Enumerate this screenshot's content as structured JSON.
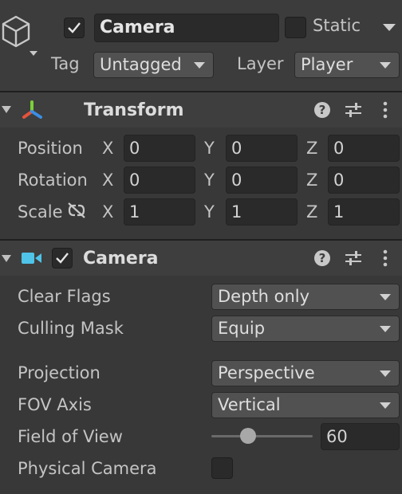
{
  "gameobject": {
    "active": true,
    "name": "Camera",
    "static_label": "Static",
    "static_checked": false,
    "tag_label": "Tag",
    "tag_value": "Untagged",
    "layer_label": "Layer",
    "layer_value": "Player"
  },
  "transform": {
    "title": "Transform",
    "rows": [
      {
        "label": "Position",
        "x": "0",
        "y": "0",
        "z": "0"
      },
      {
        "label": "Rotation",
        "x": "0",
        "y": "0",
        "z": "0"
      },
      {
        "label": "Scale",
        "x": "1",
        "y": "1",
        "z": "1"
      }
    ],
    "axis": {
      "x": "X",
      "y": "Y",
      "z": "Z"
    }
  },
  "camera": {
    "title": "Camera",
    "enabled": true,
    "fields": {
      "clear_flags": {
        "label": "Clear Flags",
        "value": "Depth only"
      },
      "culling_mask": {
        "label": "Culling Mask",
        "value": "Equip"
      },
      "projection": {
        "label": "Projection",
        "value": "Perspective"
      },
      "fov_axis": {
        "label": "FOV Axis",
        "value": "Vertical"
      },
      "field_of_view": {
        "label": "Field of View",
        "value": "60",
        "slider_fraction": 0.36
      },
      "physical_camera": {
        "label": "Physical Camera",
        "checked": false
      }
    }
  },
  "colors": {
    "background": "#383838",
    "header": "#3e3e3e",
    "field": "#2a2a2a",
    "dropdown": "#515151",
    "transform_icon_x": "#e5533c",
    "transform_icon_y": "#7ccf3a",
    "transform_icon_z": "#3b8ee5",
    "camera_icon": "#4fc3e8"
  },
  "icons": {
    "gameobject": "cube-icon",
    "transform": "transform-axes-icon",
    "camera": "video-camera-icon",
    "help": "help-circle-icon",
    "settings": "sliders-icon",
    "menu": "kebab-menu-icon",
    "constrain": "link-broken-icon",
    "foldout": "triangle-down-icon"
  }
}
